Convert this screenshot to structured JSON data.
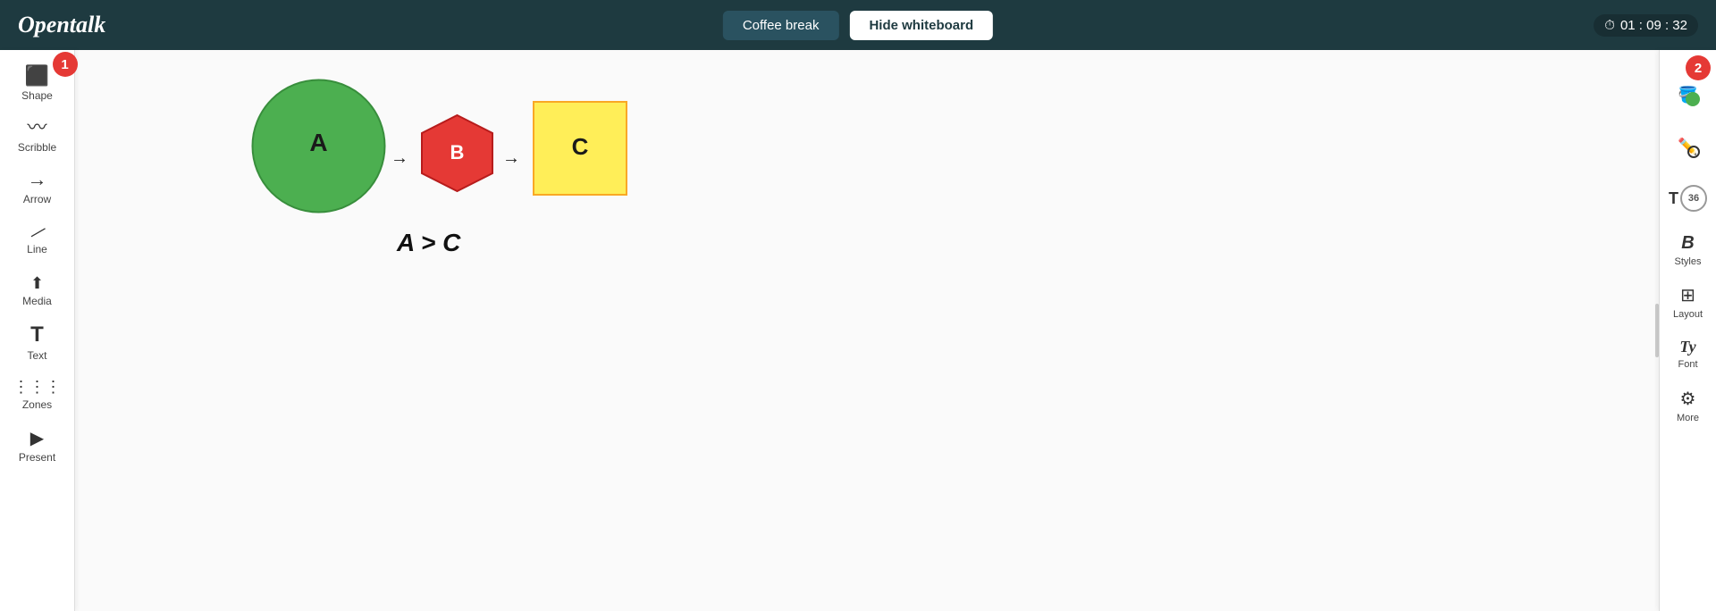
{
  "header": {
    "logo": "Opentalk",
    "coffee_break_label": "Coffee break",
    "hide_whiteboard_label": "Hide whiteboard",
    "timer": "01 : 09 : 32"
  },
  "left_toolbar": {
    "tools": [
      {
        "id": "shape",
        "label": "Shape",
        "icon": "▣"
      },
      {
        "id": "scribble",
        "label": "Scribble",
        "icon": "〜"
      },
      {
        "id": "arrow",
        "label": "Arrow",
        "icon": "→"
      },
      {
        "id": "line",
        "label": "Line",
        "icon": "╱"
      },
      {
        "id": "media",
        "label": "Media",
        "icon": "⬆"
      },
      {
        "id": "text",
        "label": "Text",
        "icon": "T"
      },
      {
        "id": "zones",
        "label": "Zones",
        "icon": "≡"
      },
      {
        "id": "present",
        "label": "Present",
        "icon": "▶"
      }
    ],
    "badge_label": "1"
  },
  "right_toolbar": {
    "badge_label": "2",
    "color_label": "",
    "stroke_label": "",
    "font_size_value": "36",
    "styles_label": "Styles",
    "layout_label": "Layout",
    "font_label": "Font",
    "more_label": "More"
  },
  "canvas": {
    "shape_a_label": "A",
    "shape_b_label": "B",
    "shape_c_label": "C",
    "text_content": "A > C"
  }
}
